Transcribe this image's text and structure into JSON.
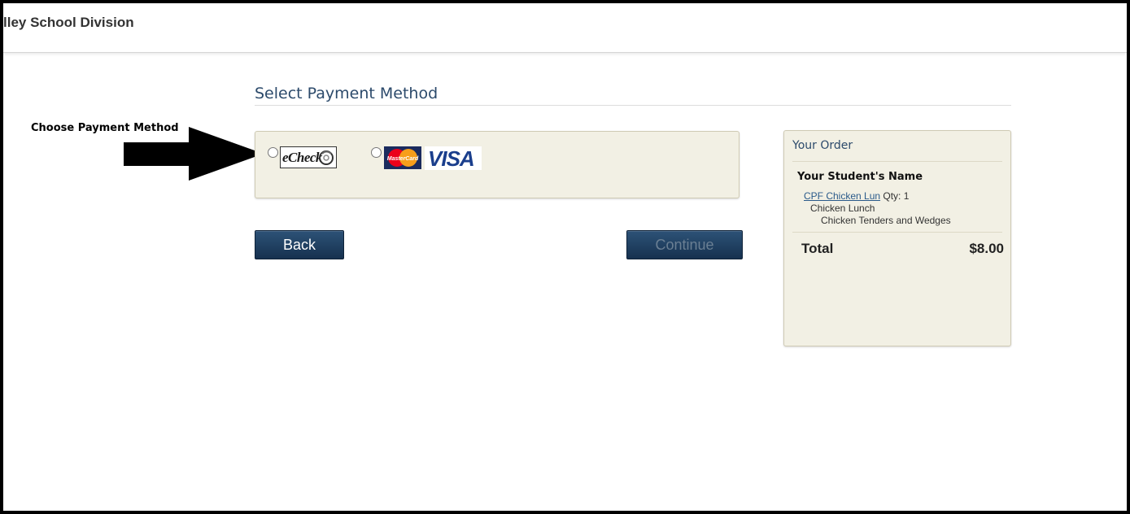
{
  "header": {
    "site_title": "lley School Division"
  },
  "annotation": {
    "label": "Choose Payment Method",
    "arrow_color": "#000000"
  },
  "payment": {
    "section_title": "Select Payment Method",
    "options": [
      {
        "id": "echeck",
        "logo_text": "eCheck",
        "selected": false
      },
      {
        "id": "card",
        "logos": [
          "MasterCard",
          "VISA"
        ],
        "selected": false
      }
    ]
  },
  "buttons": {
    "back_label": "Back",
    "continue_label": "Continue"
  },
  "order": {
    "title": "Your Order",
    "student_name": "Your Student's Name",
    "item": {
      "link_text": "CPF Chicken Lun",
      "qty_text": " Qty: 1",
      "line1": "Chicken Lunch",
      "line2": "Chicken Tenders and Wedges"
    },
    "total_label": "Total",
    "total_value": "$8.00"
  },
  "colors": {
    "panel_bg": "#f2f0e4",
    "title_blue": "#2c4a6b",
    "button_dark": "#16314f",
    "mastercard_red": "#eb001b",
    "mastercard_orange": "#f79e1b",
    "visa_blue": "#1a3e8c"
  }
}
